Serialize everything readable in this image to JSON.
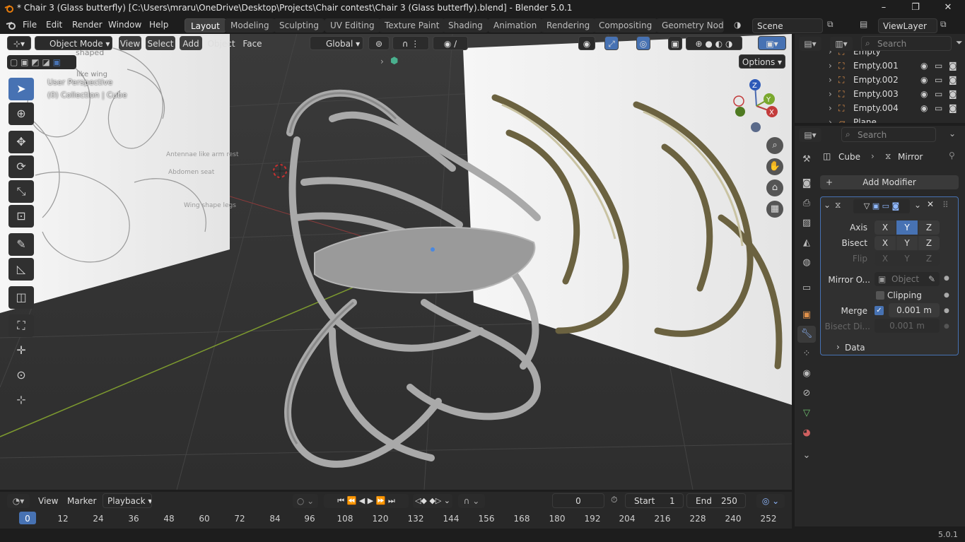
{
  "window": {
    "title": "* Chair  3 (Glass butterfly) [C:\\Users\\mraru\\OneDrive\\Desktop\\Projects\\Chair contest\\Chair  3 (Glass butterfly).blend] - Blender 5.0.1",
    "minimize": "–",
    "maximize": "❐",
    "close": "✕"
  },
  "menubar": {
    "items": [
      "File",
      "Edit",
      "Render",
      "Window",
      "Help"
    ],
    "workspaces": [
      "Layout",
      "Modeling",
      "Sculpting",
      "UV Editing",
      "Texture Paint",
      "Shading",
      "Animation",
      "Rendering",
      "Compositing",
      "Geometry Nodes"
    ],
    "active_workspace": "Layout",
    "scene": "Scene",
    "view_layer": "ViewLayer"
  },
  "viewport_header": {
    "mode": "Object Mode",
    "menus": [
      "View",
      "Select",
      "Add",
      "Object",
      "Face"
    ],
    "orientation": "Global",
    "options": "Options"
  },
  "viewport": {
    "perspective_label": "User Perspective",
    "collection_label": "(0) Collection | Cube",
    "tools": [
      "select-box",
      "cursor",
      "move",
      "rotate",
      "scale",
      "transform",
      "annotate",
      "measure",
      "add-cube",
      "extra-1",
      "extra-2",
      "extra-3",
      "extra-4"
    ],
    "gizmo": {
      "z": "Z",
      "y": "Y",
      "x": "X"
    },
    "sketch_notes": [
      "shaped",
      "like wing",
      "Antennae like arm rest",
      "Abdomen seat",
      "Wing shape legs"
    ]
  },
  "outliner": {
    "search_placeholder": "Search",
    "rows": [
      "Empty",
      "Empty.001",
      "Empty.002",
      "Empty.003",
      "Empty.004",
      "Plane"
    ]
  },
  "properties": {
    "search_placeholder": "Search",
    "breadcrumb_object": "Cube",
    "breadcrumb_modifier": "Mirror",
    "add_modifier": "Add Modifier",
    "axis_label": "Axis",
    "bisect_label": "Bisect",
    "flip_label": "Flip",
    "axes": [
      "X",
      "Y",
      "Z"
    ],
    "mirror_object_label": "Mirror O...",
    "mirror_object_placeholder": "Object",
    "clipping_label": "Clipping",
    "merge_label": "Merge",
    "merge_value": "0.001 m",
    "bisect_distance_label": "Bisect Di...",
    "bisect_distance_value": "0.001 m",
    "data_label": "Data"
  },
  "timeline": {
    "menus": [
      "View",
      "Marker"
    ],
    "playback": "Playback",
    "current_frame": "0",
    "start_label": "Start",
    "start_value": "1",
    "end_label": "End",
    "end_value": "250",
    "ticks": [
      "0",
      "12",
      "24",
      "36",
      "48",
      "60",
      "72",
      "84",
      "96",
      "108",
      "120",
      "132",
      "144",
      "156",
      "168",
      "180",
      "192",
      "204",
      "216",
      "228",
      "240",
      "252"
    ]
  },
  "statusbar": {
    "version": "5.0.1"
  },
  "colors": {
    "accent": "#4772b3",
    "background": "#1d1d1d",
    "panel": "#282828",
    "viewport": "#383838"
  }
}
